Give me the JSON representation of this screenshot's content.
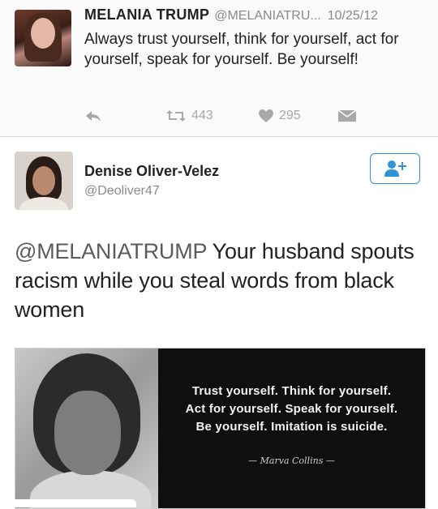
{
  "tweet1": {
    "name": "MELANIA TRUMP",
    "handle": "@MELANIATRU...",
    "date": "10/25/12",
    "text": "Always trust yourself, think for yourself, act for yourself, speak for yourself. Be yourself!",
    "retweets": "443",
    "likes": "295"
  },
  "tweet2": {
    "name": "Denise Oliver-Velez",
    "handle": "@Deoliver47",
    "mention": "@MELANIATRUMP",
    "text": " Your husband spouts racism while you steal words from black women",
    "quote": {
      "lines": [
        "Trust yourself. Think for yourself.",
        "Act for yourself. Speak for yourself.",
        "Be yourself. Imitation is suicide."
      ],
      "author": "— Marva Collins —"
    }
  },
  "icons": {
    "reply": "reply-icon",
    "retweet": "retweet-icon",
    "like": "heart-icon",
    "dm": "envelope-icon",
    "follow": "add-user-icon"
  },
  "colors": {
    "accent": "#2f93d6",
    "muted": "#8a8a8a"
  }
}
